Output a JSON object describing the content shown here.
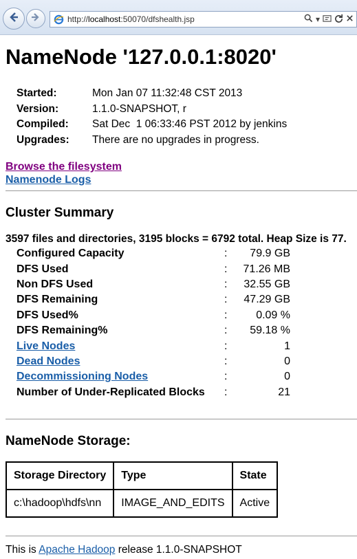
{
  "browser": {
    "url_prefix": "http://",
    "url_host": "localhost",
    "url_rest": ":50070/dfshealth.jsp"
  },
  "page": {
    "title": "NameNode '127.0.0.1:8020'",
    "info": [
      {
        "label": "Started:",
        "value": "Mon Jan 07 11:32:48 CST 2013"
      },
      {
        "label": "Version:",
        "value": "1.1.0-SNAPSHOT, r"
      },
      {
        "label": "Compiled:",
        "value": "Sat Dec  1 06:33:46 PST 2012 by jenkins"
      },
      {
        "label": "Upgrades:",
        "value": "There are no upgrades in progress."
      }
    ],
    "links": {
      "browse_fs": "Browse the filesystem",
      "namenode_logs": "Namenode Logs"
    }
  },
  "cluster": {
    "heading": "Cluster Summary",
    "summary_line": "3597 files and directories, 3195 blocks = 6792 total. Heap Size is 77.",
    "colon": ":",
    "rows": [
      {
        "label": "Configured Capacity",
        "value": "79.9 GB"
      },
      {
        "label": "DFS Used",
        "value": "71.26 MB"
      },
      {
        "label": "Non DFS Used",
        "value": "32.55 GB"
      },
      {
        "label": "DFS Remaining",
        "value": "47.29 GB"
      },
      {
        "label": "DFS Used%",
        "value": "0.09 %"
      },
      {
        "label": "DFS Remaining%",
        "value": "59.18 %"
      },
      {
        "label": "Live Nodes",
        "value": "1"
      },
      {
        "label": "Dead Nodes",
        "value": "0"
      },
      {
        "label": "Decommissioning Nodes",
        "value": "0"
      },
      {
        "label": "Number of Under-Replicated Blocks",
        "value": "21"
      }
    ]
  },
  "storage": {
    "heading": "NameNode Storage:",
    "headers": [
      "Storage Directory",
      "Type",
      "State"
    ],
    "row": [
      "c:\\hadoop\\hdfs\\nn",
      "IMAGE_AND_EDITS",
      "Active"
    ]
  },
  "footer": {
    "prefix": "This is",
    "link": "Apache Hadoop",
    "suffix": "release 1.1.0-SNAPSHOT"
  }
}
